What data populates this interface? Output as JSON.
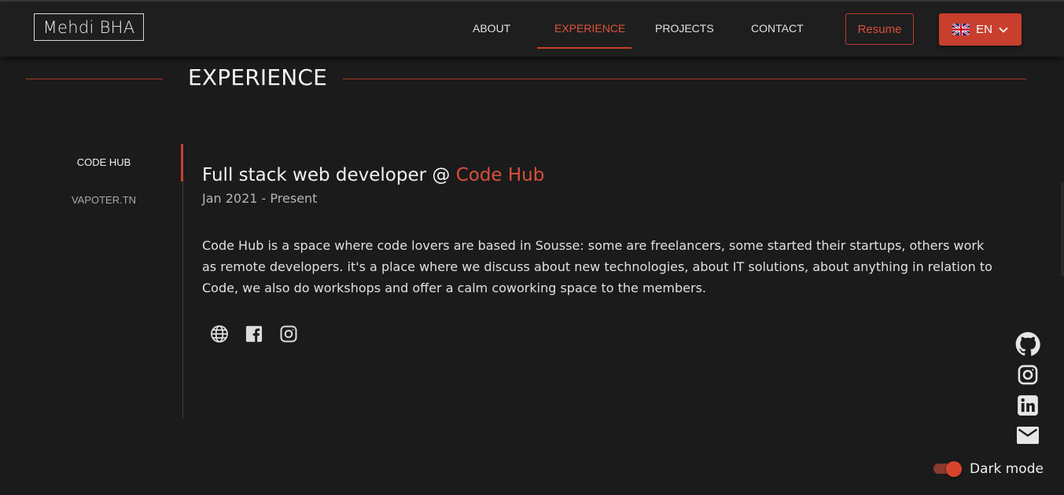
{
  "header": {
    "logo": "Mehdi BHA",
    "nav": [
      {
        "label": "ABOUT"
      },
      {
        "label": "EXPERIENCE"
      },
      {
        "label": "PROJECTS"
      },
      {
        "label": "CONTACT"
      }
    ],
    "active_nav": "EXPERIENCE",
    "resume_label": "Resume",
    "language": {
      "flag": "uk-flag-icon",
      "label": "EN"
    }
  },
  "section": {
    "title": "EXPERIENCE"
  },
  "companies": [
    {
      "label": "CODE HUB",
      "active": true
    },
    {
      "label": "VAPOTER.TN",
      "active": false
    }
  ],
  "job": {
    "title_prefix": "Full stack web developer @ ",
    "company": "Code Hub",
    "dates": "Jan 2021 - Present",
    "description": "Code Hub is a space where code lovers are based in Sousse: some are freelancers, some started their startups, others work as remote developers. it's a place where we discuss about new technologies, about IT solutions, about anything in relation to Code, we also do workshops and offer a calm coworking space to the members.",
    "links": [
      "globe-icon",
      "facebook-icon",
      "instagram-icon"
    ]
  },
  "social": [
    "github-icon",
    "instagram-icon",
    "linkedin-icon",
    "mail-icon"
  ],
  "dark_mode": {
    "label": "Dark mode",
    "enabled": true
  },
  "colors": {
    "accent": "#c8402d",
    "background": "#1b1b1b",
    "header": "#1e1e1e"
  }
}
